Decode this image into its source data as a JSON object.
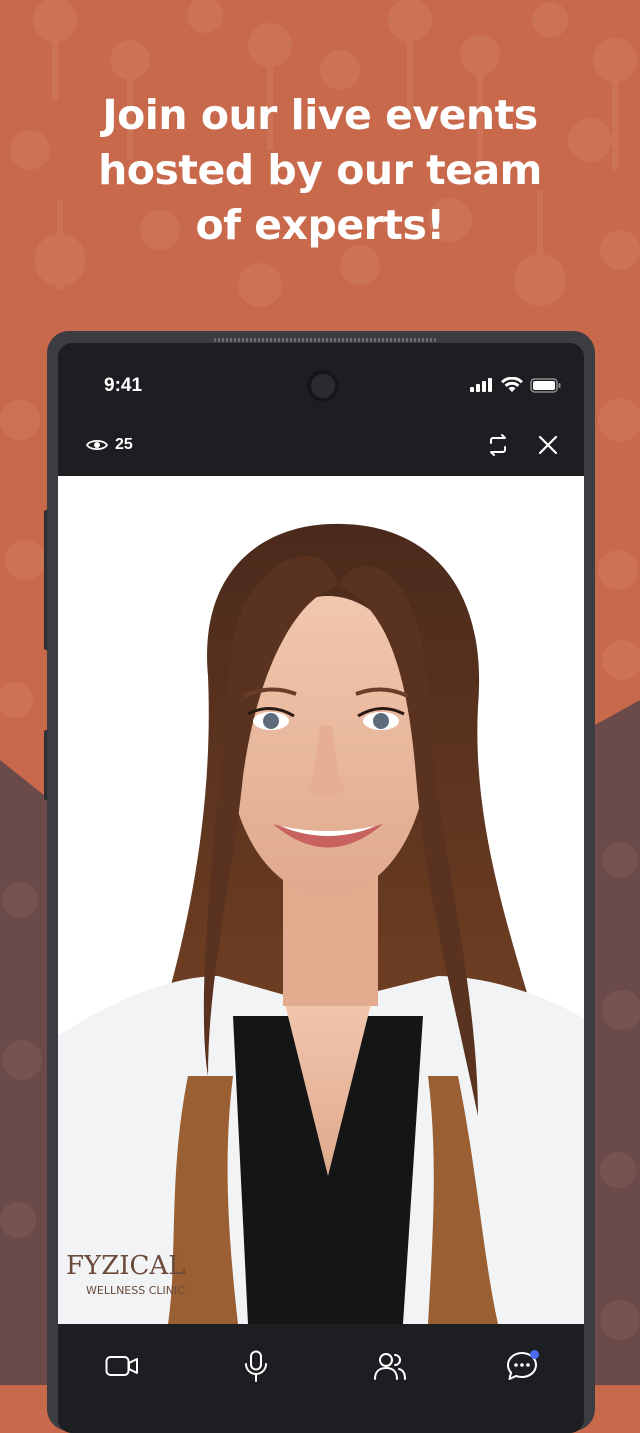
{
  "headline": {
    "line1": "Join our live events",
    "line2": "hosted by our team",
    "line3": "of experts!"
  },
  "status_bar": {
    "time": "9:41",
    "icons": [
      "signal-icon",
      "wifi-icon",
      "battery-icon"
    ]
  },
  "live_header": {
    "viewer_icon": "eye-icon",
    "viewer_count": "25",
    "actions": [
      "switch-camera-icon",
      "close-icon"
    ]
  },
  "video": {
    "logo_text_1": "FYZICAL",
    "logo_text_2": "WELLNESS CLINIC"
  },
  "toolbar": {
    "items": [
      "video-camera-icon",
      "microphone-icon",
      "participants-icon",
      "chat-icon"
    ]
  },
  "colors": {
    "background": "#c9694c",
    "background_dark": "#6b4b49",
    "phone_frame": "#3b3d42",
    "screen_dark": "#1c1e22",
    "notification_dot": "#4a6cf7"
  }
}
